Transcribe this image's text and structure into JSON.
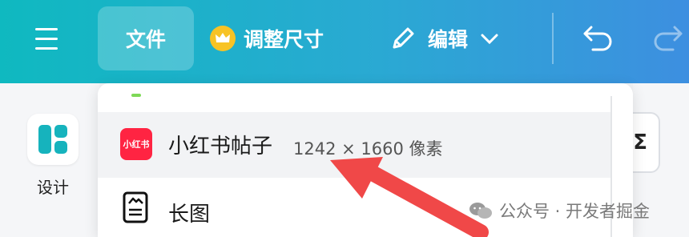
{
  "toolbar": {
    "file_label": "文件",
    "resize_label": "调整尺寸",
    "edit_label": "编辑"
  },
  "sidebar": {
    "design_label": "设计"
  },
  "dropdown": {
    "items": [
      {
        "logo_text": "小红书",
        "title": "小红书帖子",
        "dimensions": "1242 × 1660 像素"
      },
      {
        "title": "长图"
      }
    ]
  },
  "right_panel": {
    "button_text": "Σ"
  },
  "watermark": {
    "text": "公众号 · 开发者掘金"
  },
  "colors": {
    "topbar_start": "#0fb9c0",
    "topbar_end": "#3d8fe0",
    "crown": "#f7c325",
    "xhs_brand": "#ff2442",
    "design_icon": "#16b3bd",
    "annotation_arrow": "#f04848"
  },
  "icons": [
    "hamburger-icon",
    "crown-icon",
    "pencil-icon",
    "chevron-down-icon",
    "undo-icon",
    "redo-icon",
    "design-icon",
    "long-image-icon",
    "wechat-icon"
  ]
}
